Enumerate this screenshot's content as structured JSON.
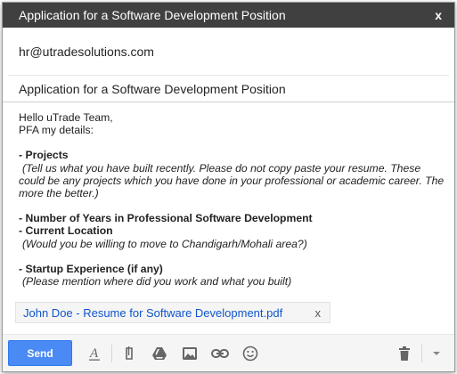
{
  "window": {
    "title": "Application for a Software Development Position",
    "close_label": "x"
  },
  "compose": {
    "to": "hr@utradesolutions.com",
    "subject": "Application for a Software Development Position"
  },
  "message": {
    "greeting": "Hello uTrade Team,",
    "intro": "PFA my details:",
    "projects_heading": "- Projects",
    "projects_note_1": " (Tell us what you have built recently. Please do not copy paste your resume. These",
    "projects_note_2": "could be any projects which you have done in your professional or academic career. The",
    "projects_note_3": "more the better.)",
    "years_heading": "- Number of Years in Professional Software Development",
    "location_heading": "- Current Location",
    "location_note": " (Would you be willing to move to Chandigarh/Mohali area?)",
    "startup_heading": "- Startup Experience (if any)",
    "startup_note": " (Please mention where did you work and what you built)"
  },
  "attachment": {
    "name": "John Doe - Resume for Software Development.pdf",
    "remove_label": "x"
  },
  "toolbar": {
    "send_label": "Send",
    "icons": [
      "formatting-icon",
      "attach-icon",
      "drive-icon",
      "photo-icon",
      "link-icon",
      "emoji-icon",
      "trash-icon",
      "more-options-icon"
    ],
    "accent_color": "#4a8af4",
    "title_bar_color": "#404040",
    "link_color": "#1155cc"
  }
}
